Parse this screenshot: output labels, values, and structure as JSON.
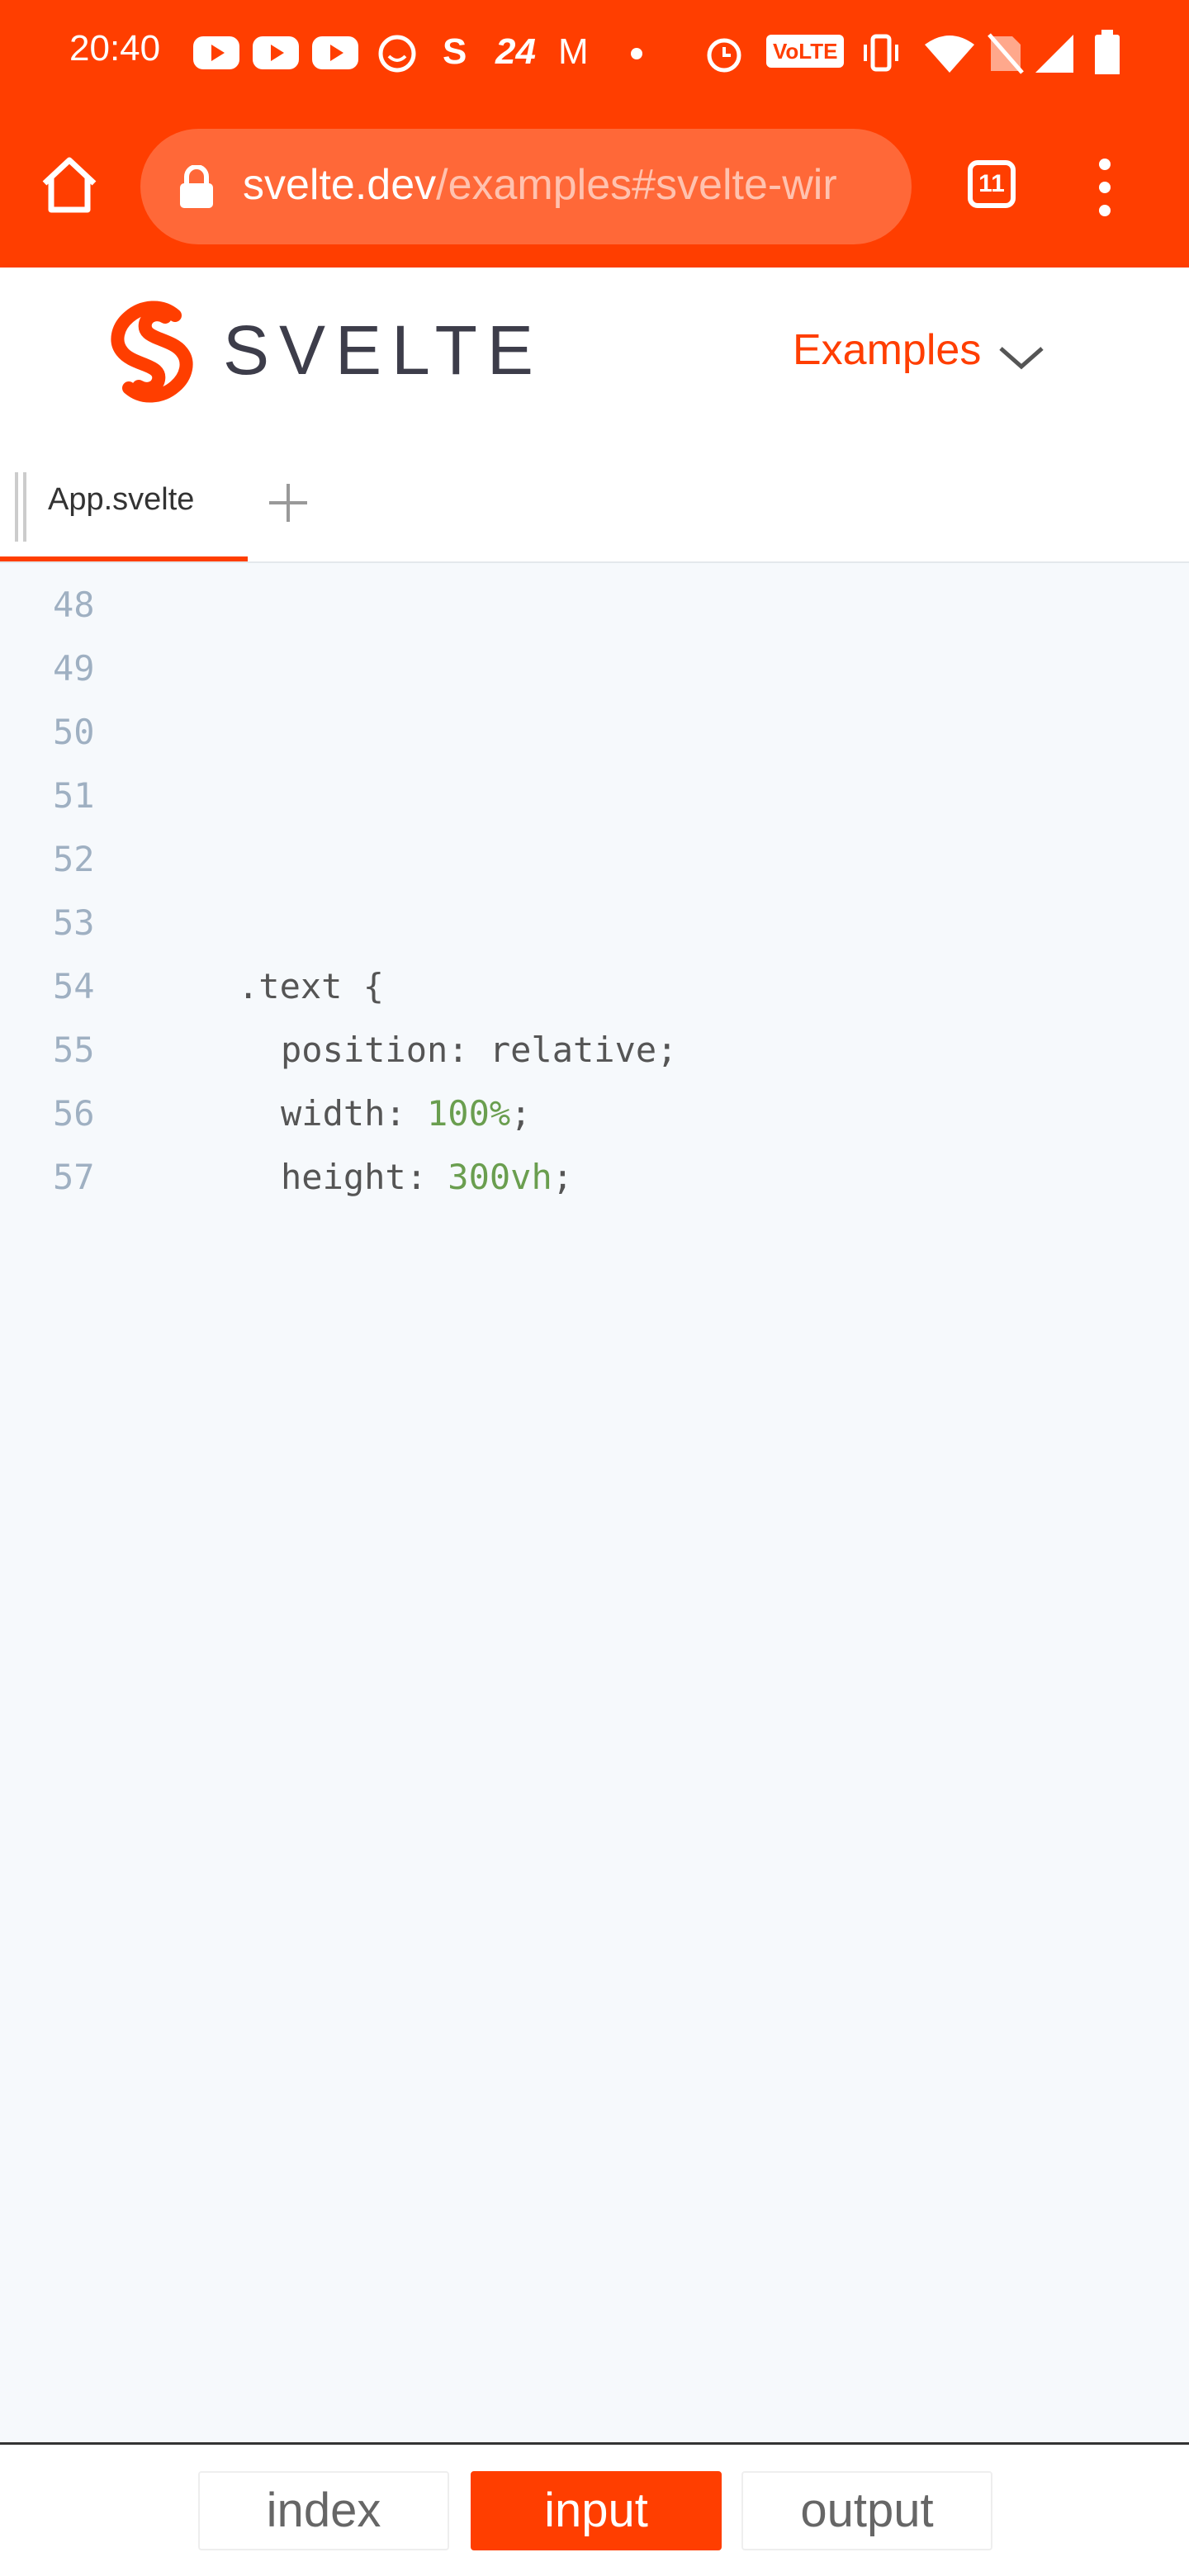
{
  "status_bar": {
    "time": "20:40",
    "icons": [
      "youtube-icon",
      "youtube-icon",
      "youtube-icon",
      "face-icon",
      "s-icon",
      "24-icon",
      "mcdonalds-icon",
      "dot-icon",
      "alarm-icon",
      "volte-icon",
      "vibrate-icon",
      "wifi-icon",
      "no-sim-icon",
      "signal-icon",
      "battery-icon"
    ],
    "glyph_s": "S",
    "glyph_24": "24",
    "glyph_m": "M",
    "volte_label": "VoLTE"
  },
  "browser": {
    "url_domain": "svelte.dev",
    "url_path": "/examples#svelte-wir",
    "tab_count": "11"
  },
  "site": {
    "logo_text": "SVELTE",
    "nav_label": "Examples",
    "brand_color": "#ff3e00"
  },
  "editor": {
    "tab_label": "App.svelte",
    "lines": [
      {
        "no": "48",
        "indent": 0,
        "text": ""
      },
      {
        "no": "49",
        "indent": 0,
        "text": ""
      },
      {
        "no": "50",
        "indent": 0,
        "text": ""
      },
      {
        "no": "51",
        "indent": 0,
        "text": ""
      },
      {
        "no": "52",
        "indent": 0,
        "text": ""
      },
      {
        "no": "53",
        "indent": 0,
        "text": ""
      },
      {
        "no": "54",
        "indent": 1,
        "text": ".text {"
      },
      {
        "no": "55",
        "indent": 2,
        "text": "position: relative;"
      },
      {
        "no": "56",
        "indent": 2,
        "prop": "width: ",
        "num": "100%",
        "end": ";"
      },
      {
        "no": "57",
        "indent": 2,
        "prop": "height: ",
        "num": "300vh",
        "end": ";"
      }
    ]
  },
  "bottom_toggle": {
    "buttons": [
      {
        "label": "index",
        "active": false
      },
      {
        "label": "input",
        "active": true
      },
      {
        "label": "output",
        "active": false
      }
    ]
  }
}
